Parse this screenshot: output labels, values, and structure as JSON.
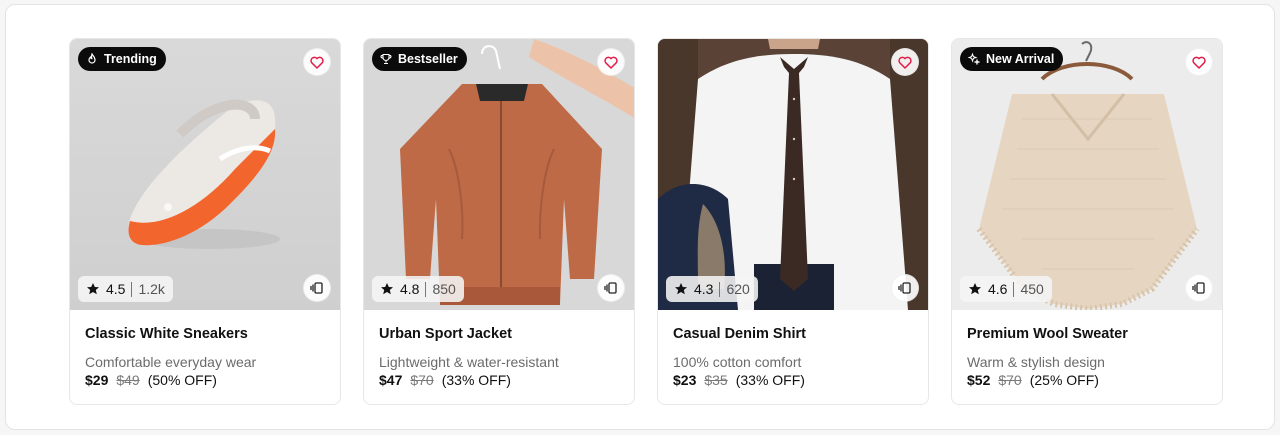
{
  "products": [
    {
      "badge": "Trending",
      "badge_icon": "flame-icon",
      "rating": "4.5",
      "reviews": "1.2k",
      "title": "Classic White Sneakers",
      "desc": "Comfortable everyday wear",
      "price": "$29",
      "old_price": "$49",
      "discount": "(50% OFF)"
    },
    {
      "badge": "Bestseller",
      "badge_icon": "trophy-icon",
      "rating": "4.8",
      "reviews": "850",
      "title": "Urban Sport Jacket",
      "desc": "Lightweight & water-resistant",
      "price": "$47",
      "old_price": "$70",
      "discount": "(33% OFF)"
    },
    {
      "badge": "",
      "badge_icon": "",
      "rating": "4.3",
      "reviews": "620",
      "title": "Casual Denim Shirt",
      "desc": "100% cotton comfort",
      "price": "$23",
      "old_price": "$35",
      "discount": "(33% OFF)"
    },
    {
      "badge": "New Arrival",
      "badge_icon": "sparkles-icon",
      "rating": "4.6",
      "reviews": "450",
      "title": "Premium Wool Sweater",
      "desc": "Warm & stylish design",
      "price": "$52",
      "old_price": "$70",
      "discount": "(25% OFF)"
    }
  ],
  "colors": {
    "heart": "#e11d48",
    "badge_bg": "#0b0b0b",
    "muted_text": "#6b6b6b"
  }
}
